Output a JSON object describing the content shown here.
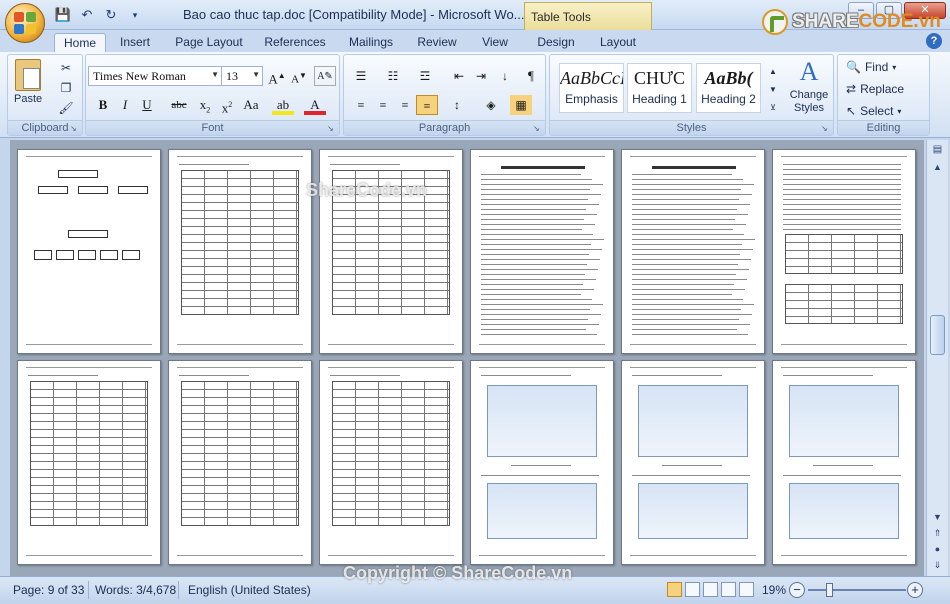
{
  "window": {
    "title": "Bao cao thuc tap.doc [Compatibility Mode] - Microsoft Wo...",
    "contextual_tab_group": "Table Tools",
    "controls": [
      "–",
      "▢",
      "✕"
    ]
  },
  "watermarks": {
    "logo_prefix": "SHARE",
    "logo_suffix": "CODE.vn",
    "center": "ShareCode.vn",
    "bottom": "Copyright © ShareCode.vn"
  },
  "tabs": [
    "Home",
    "Insert",
    "Page Layout",
    "References",
    "Mailings",
    "Review",
    "View",
    "Design",
    "Layout"
  ],
  "active_tab": "Home",
  "ribbon": {
    "clipboard": {
      "label": "Clipboard",
      "paste": "Paste"
    },
    "font": {
      "label": "Font",
      "name": "Times New Roman",
      "size": "13"
    },
    "paragraph": {
      "label": "Paragraph"
    },
    "styles": {
      "label": "Styles",
      "items": [
        {
          "sample": "AaBbCcI",
          "name": "Emphasis"
        },
        {
          "sample": "CHƯC",
          "name": "Heading 1"
        },
        {
          "sample": "AaBb(",
          "name": "Heading 2"
        }
      ],
      "change_styles": "Change Styles"
    },
    "editing": {
      "label": "Editing",
      "find": "Find",
      "replace": "Replace",
      "select": "Select"
    }
  },
  "status": {
    "page": "Page: 9 of 33",
    "words": "Words: 3/4,678",
    "language": "English (United States)",
    "zoom": "19%",
    "zoom_level": 0.19
  },
  "accent_colors": {
    "ribbon": "#dde8f6",
    "active_view": "#f7d27d",
    "document_bg": "#9aa7b8"
  }
}
